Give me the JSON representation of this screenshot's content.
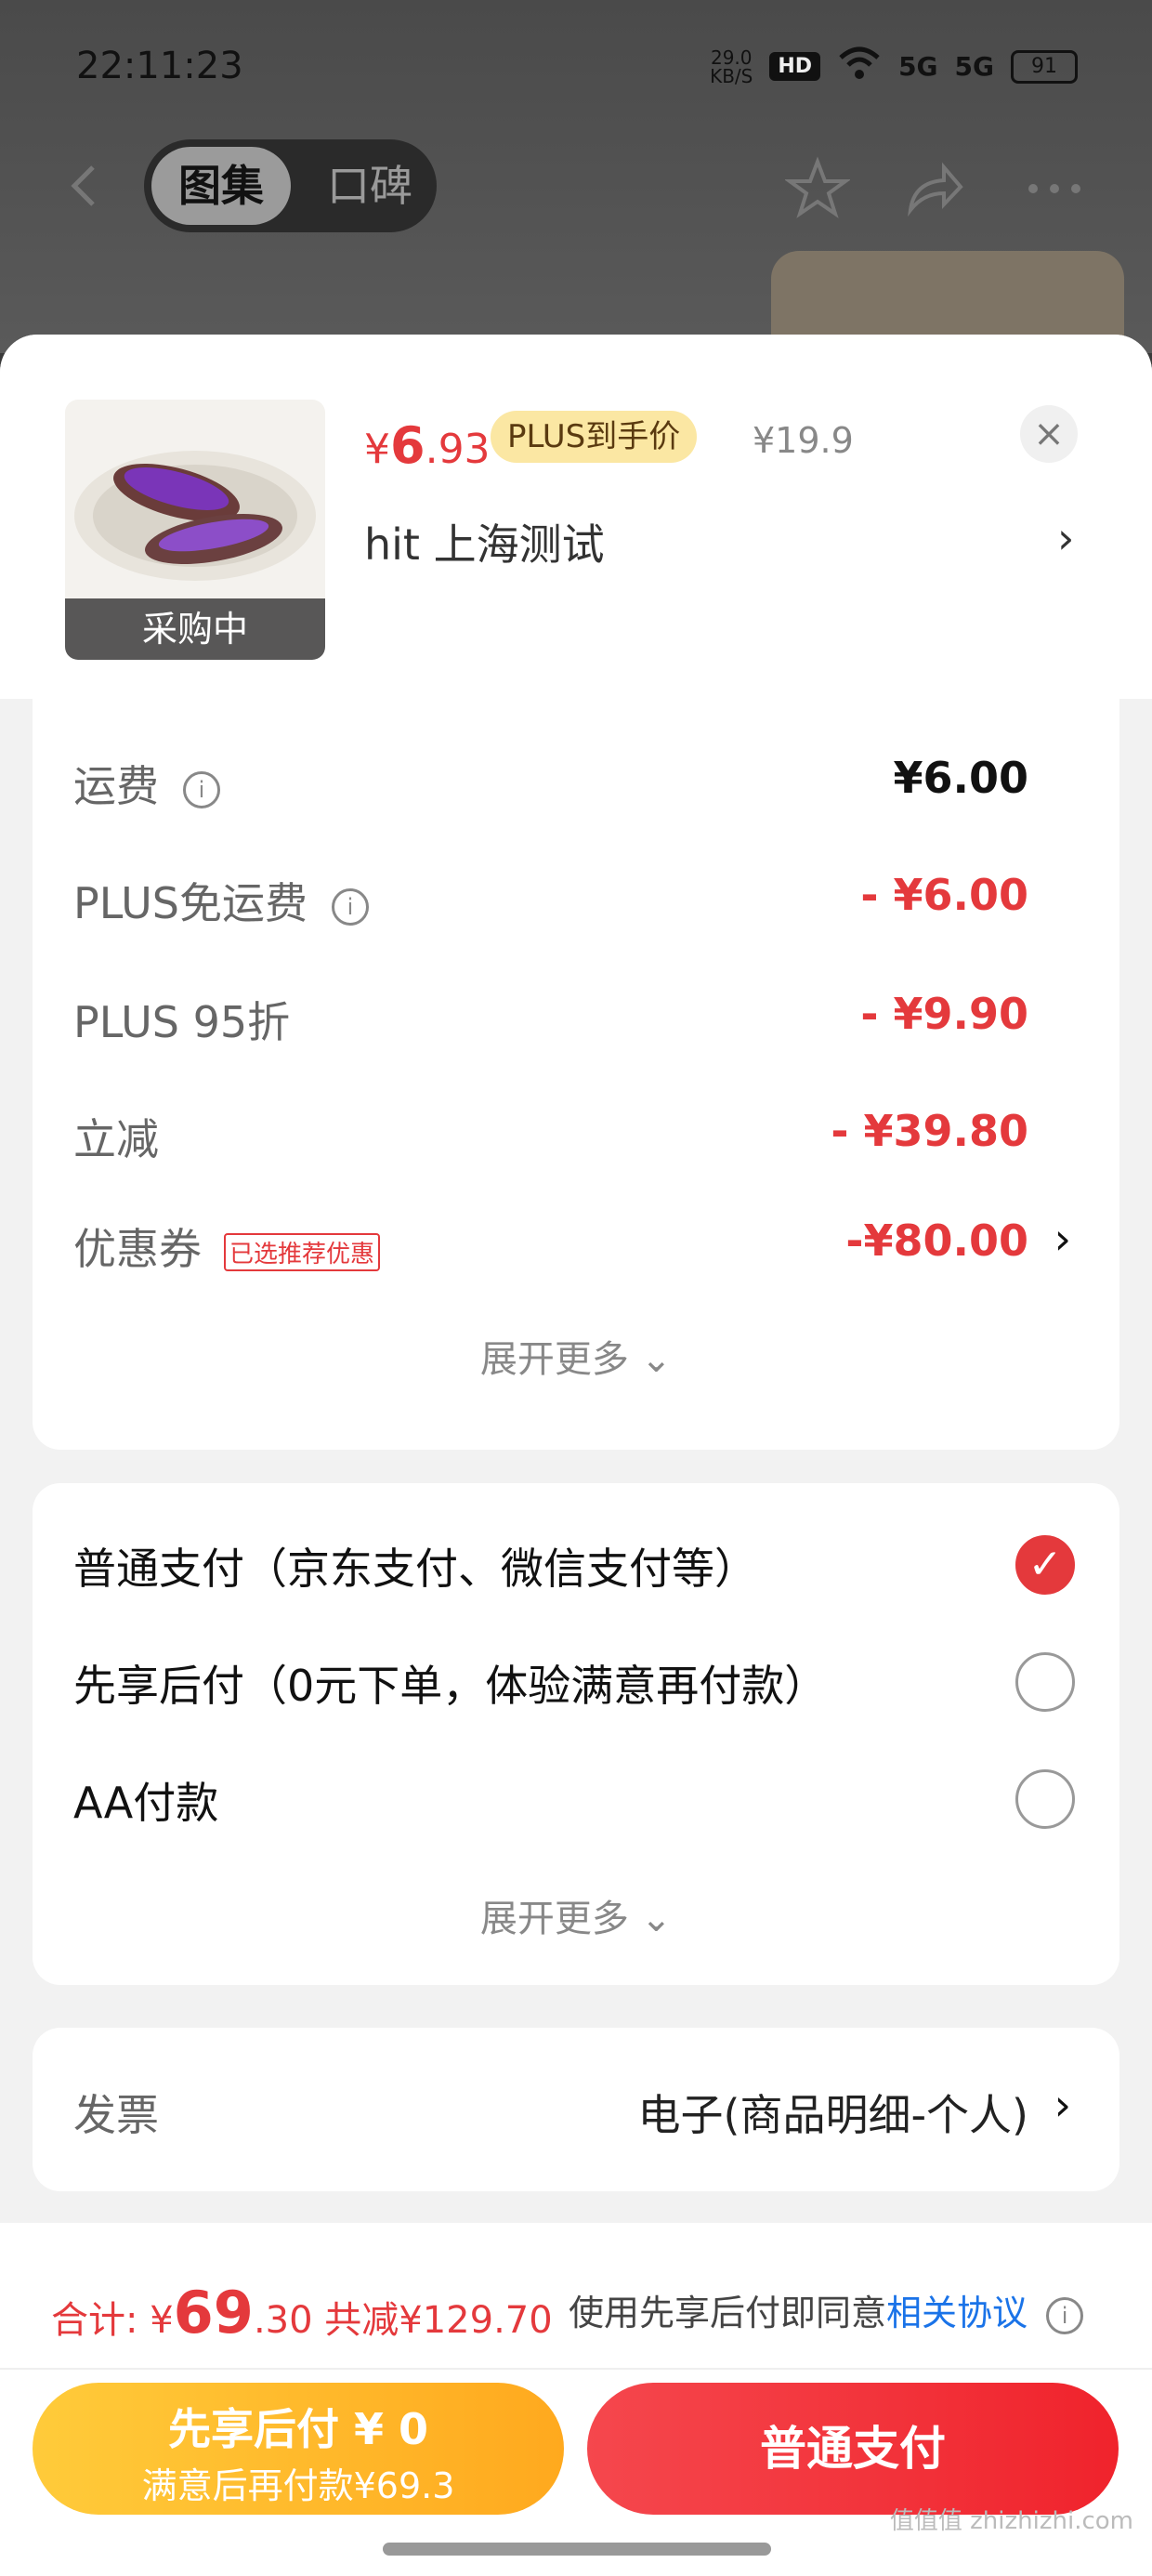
{
  "status": {
    "time": "22:11:23",
    "net_speed": "29.0",
    "net_unit": "KB/S",
    "hd": "HD",
    "signal1": "5G",
    "signal2": "5G",
    "battery": "91"
  },
  "topbar": {
    "tab_active": "图集",
    "tab_inactive": "口碑"
  },
  "product": {
    "image_tag": "采购中",
    "price_symbol": "¥",
    "price_main": "6",
    "price_decimal": ".93",
    "plus_tag": "PLUS到手价",
    "original_price": "¥19.9",
    "name": "hit  上海测试"
  },
  "fees": {
    "shipping_label": "运费",
    "shipping_value": "¥6.00",
    "plus_free_label": "PLUS免运费",
    "plus_free_value": "- ¥6.00",
    "plus95_label": "PLUS 95折",
    "plus95_value": "- ¥9.90",
    "instant_label": "立减",
    "instant_value": "- ¥39.80",
    "coupon_label": "优惠券",
    "coupon_tag": "已选推荐优惠",
    "coupon_value": "-¥80.00",
    "expand": "展开更多"
  },
  "payment": {
    "options": [
      "普通支付（京东支付、微信支付等）",
      "先享后付（0元下单，体验满意再付款）",
      "AA付款"
    ],
    "selected_index": 0,
    "expand": "展开更多"
  },
  "invoice": {
    "label": "发票",
    "value": "电子(商品明细-个人)"
  },
  "footer": {
    "total_label": "合计:",
    "total_symbol": "¥",
    "total_main": "69",
    "total_decimal": ".30",
    "saved": "共减¥129.70",
    "agree_text": "使用先享后付即同意",
    "agree_link": "相关协议",
    "btn_later_line1": "先享后付 ¥ 0",
    "btn_later_line2": "满意后再付款¥69.3",
    "btn_pay": "普通支付",
    "watermark": "值值值 zhizhizhi.com"
  }
}
